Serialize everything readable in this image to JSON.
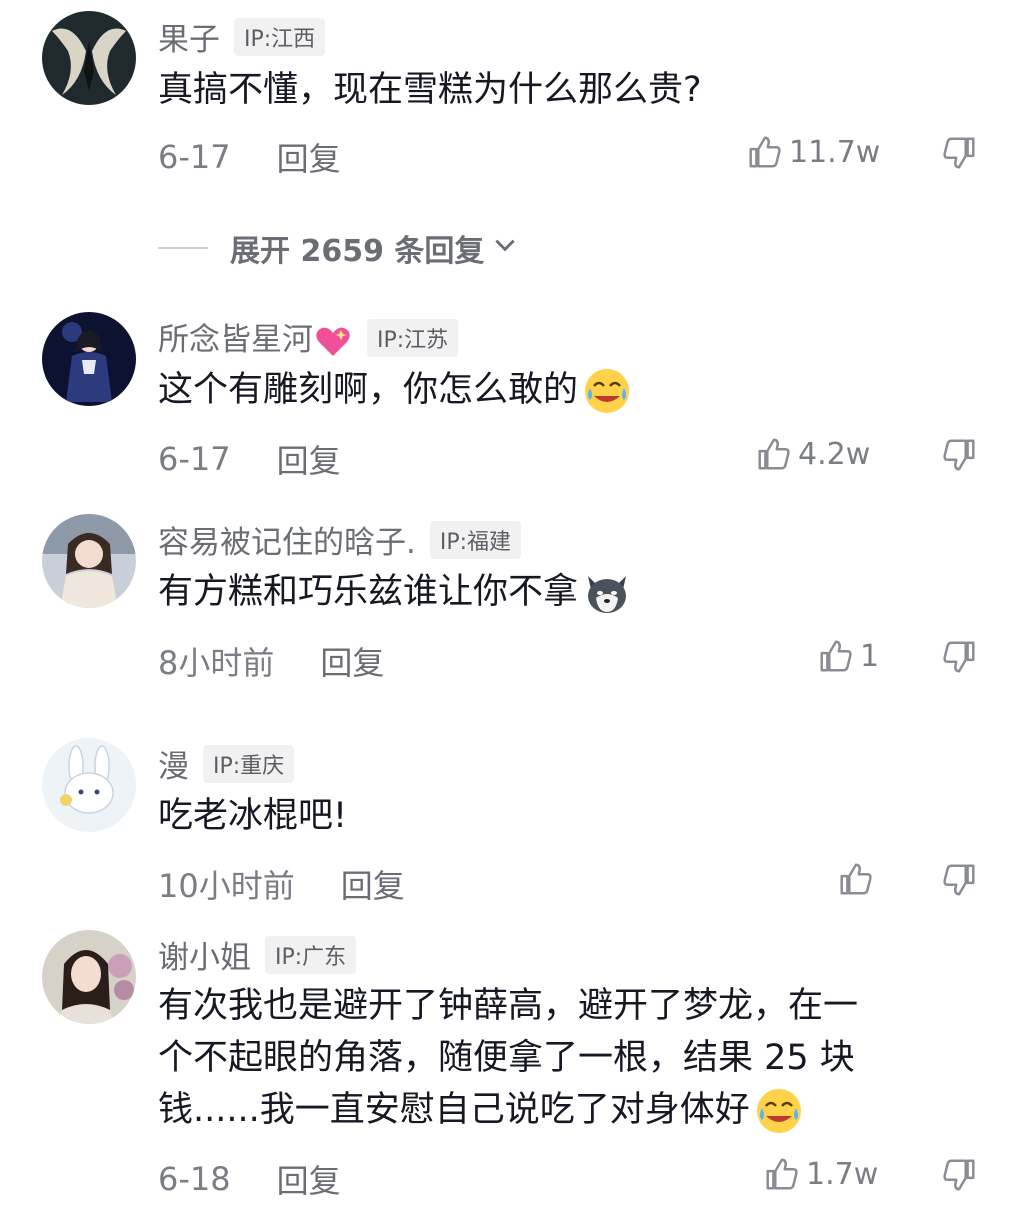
{
  "colors": {
    "text": "#161823",
    "secondary": "#6b6d75",
    "tag_bg": "#f1f1f2"
  },
  "comments": [
    {
      "username": "果子",
      "ip": "IP:江西",
      "text": "真搞不懂，现在雪糕为什么那么贵?",
      "date": "6-17",
      "reply": "回复",
      "likes": "11.7w",
      "expand": "展开 2659 条回复"
    },
    {
      "username": "所念皆星河",
      "ip": "IP:江苏",
      "text": "这个有雕刻啊，你怎么敢的",
      "emoji": "laugh-cry-emoji",
      "date": "6-17",
      "reply": "回复",
      "likes": "4.2w"
    },
    {
      "username": "容易被记住的晗子.",
      "ip": "IP:福建",
      "text": "有方糕和巧乐兹谁让你不拿",
      "emoji": "husky-dog-emoji",
      "date": "8小时前",
      "reply": "回复",
      "likes": "1"
    },
    {
      "username": "漫",
      "ip": "IP:重庆",
      "text": "吃老冰棍吧!",
      "date": "10小时前",
      "reply": "回复",
      "likes": ""
    },
    {
      "username": "谢小姐",
      "ip": "IP:广东",
      "text_lines": [
        "有次我也是避开了钟薛高，避开了梦龙，在一",
        "个不起眼的角落，随便拿了一根，结果 25 块",
        "钱......我一直安慰自己说吃了对身体好"
      ],
      "emoji": "laugh-cry-emoji",
      "date": "6-18",
      "reply": "回复",
      "likes": "1.7w"
    }
  ]
}
